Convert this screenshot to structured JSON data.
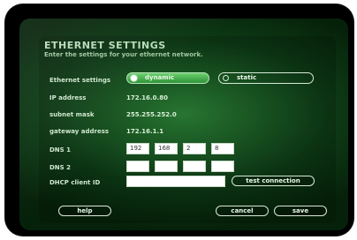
{
  "header": {
    "title": "ETHERNET SETTINGS",
    "subtitle": "Enter the settings for your ethernet network."
  },
  "ethernet": {
    "label": "Ethernet settings",
    "options": [
      {
        "label": "dynamic",
        "selected": true
      },
      {
        "label": "static",
        "selected": false
      }
    ]
  },
  "fields": {
    "ip_label": "IP address",
    "ip_value": "172.16.0.80",
    "subnet_label": "subnet mask",
    "subnet_value": "255.255.252.0",
    "gateway_label": "gateway address",
    "gateway_value": "172.16.1.1",
    "dns1_label": "DNS 1",
    "dns1_values": [
      "192",
      "168",
      "2",
      "8"
    ],
    "dns2_label": "DNS 2",
    "dns2_values": [
      "",
      "",
      "",
      ""
    ],
    "dhcp_label": "DHCP client ID",
    "dhcp_value": ""
  },
  "buttons": {
    "test_connection": "test connection",
    "help": "help",
    "cancel": "cancel",
    "save": "save"
  },
  "colors": {
    "background_center": "#2f8a3a",
    "background_edge": "#062109",
    "selected_fill": "#4fbf55"
  }
}
